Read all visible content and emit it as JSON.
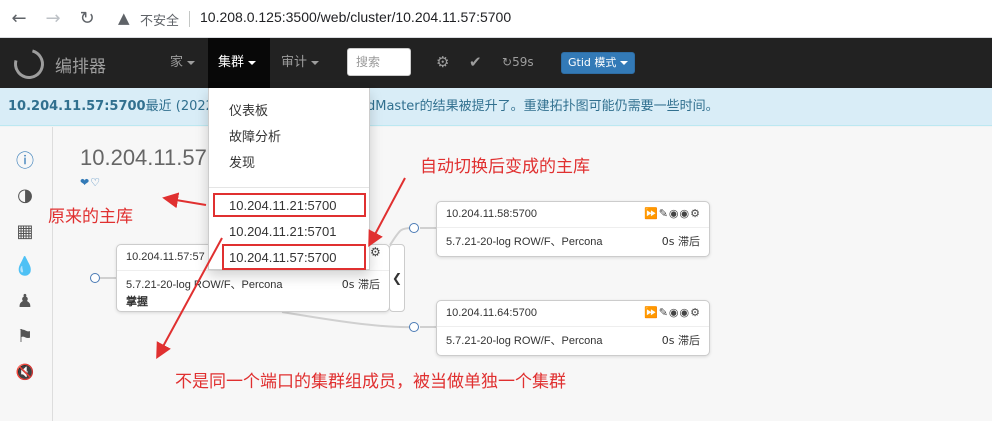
{
  "browser": {
    "insecure_label": "不安全",
    "url": "10.208.0.125:3500/web/cluster/10.204.11.57:5700"
  },
  "navbar": {
    "brand": "编排器",
    "home": "家",
    "cluster": "集群",
    "audit": "审计",
    "search_placeholder": "搜索",
    "timer": "59s",
    "mode": "Gtid 模式"
  },
  "alert": {
    "host": "10.204.11.57:5700",
    "prefix": "最近 (2022-0",
    "suffix": "dMaster的结果被提升了。重建拓扑图可能仍需要一些时间。"
  },
  "cluster_title": "10.204.11.57",
  "dropdown": {
    "items": [
      "仪表板",
      "故障分析",
      "发现"
    ],
    "hosts": [
      "10.204.11.21:5700",
      "10.204.11.21:5701",
      "10.204.11.57:5700"
    ]
  },
  "nodes": {
    "master": {
      "host": "10.204.11.57:57",
      "version": "5.7.21-20-log ROW/F、Percona",
      "lag": "0s 滞后",
      "extra": "掌握"
    },
    "replica1": {
      "host": "10.204.11.58:5700",
      "version": "5.7.21-20-log ROW/F、Percona",
      "lag": "0s 滞后"
    },
    "replica2": {
      "host": "10.204.11.64:5700",
      "version": "5.7.21-20-log ROW/F、Percona",
      "lag": "0s 滞后"
    }
  },
  "annotations": {
    "original_master": "原来的主库",
    "new_master": "自动切换后变成的主库",
    "not_member": "不是同一个端口的集群组成员，被当做单独一个集群"
  },
  "colors": {
    "annotation": "#e03030",
    "navbar": "#222222",
    "alert_bg": "#d9edf7",
    "accent": "#337ab7"
  }
}
